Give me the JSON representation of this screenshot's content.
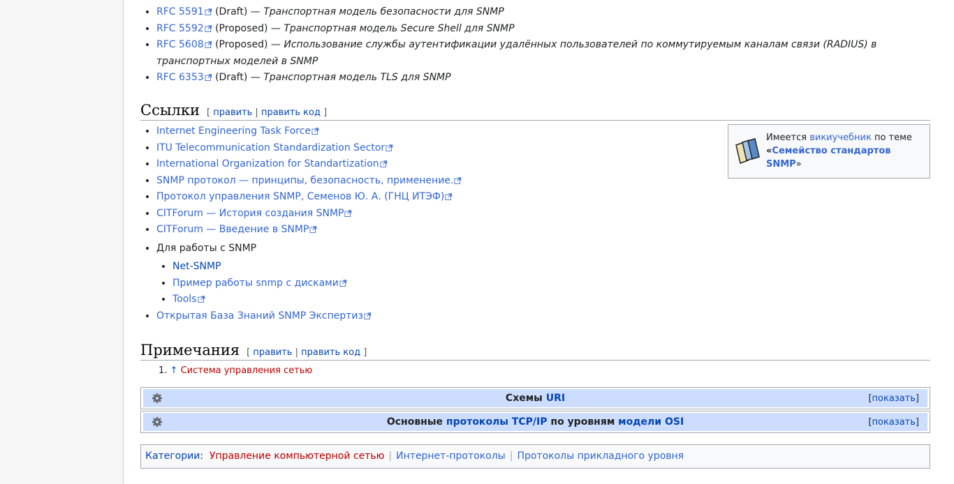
{
  "rfc_list": [
    {
      "link": "RFC 5591",
      "status": " (Draft) — ",
      "title": "Транспортная модель безопасности для SNMP"
    },
    {
      "link": "RFC 5592",
      "status": " (Proposed) — ",
      "title": "Транспортная модель Secure Shell для SNMP"
    },
    {
      "link": "RFC 5608",
      "status": " (Proposed) — ",
      "title": "Использование службы аутентификации удалённых пользователей по коммутируемым каналам связи (RADIUS) в транспортных моделей в SNMP"
    },
    {
      "link": "RFC 6353",
      "status": " (Draft) — ",
      "title": "Транспортная модель TLS для SNMP"
    }
  ],
  "links_section": {
    "heading": "Ссылки",
    "edit": "править",
    "edit_code": "править код",
    "items": [
      "Internet Engineering Task Force",
      "ITU Telecommunication Standardization Sector",
      "International Organization for Standartization",
      "SNMP протокол — принципы, безопасность, применение.",
      "Протокол управления SNMP, Семенов Ю. А. (ГНЦ ИТЭФ)",
      "CITForum — История создания SNMP",
      "CITForum — Введение в SNMP"
    ],
    "work_label": "Для работы с SNMP",
    "sub_items": {
      "net_snmp": "Net-SNMP",
      "disks": "Пример работы snmp с дисками",
      "tools": "Tools"
    },
    "last_item": "Открытая База Знаний SNMP Экспертиз"
  },
  "wikibook": {
    "prefix": "Имеется ",
    "link": "викиучебник",
    "suffix": " по теме",
    "open_quote": "«",
    "topic": "Семейство стандартов SNMP",
    "close_quote": "»"
  },
  "notes_section": {
    "heading": "Примечания",
    "edit": "править",
    "edit_code": "править код",
    "note_number": "1.",
    "note_arrow": "↑",
    "note_text": "Система управления сетью"
  },
  "navboxes": [
    {
      "part1": "Схемы ",
      "link1": "URI",
      "show": "показать"
    },
    {
      "part1": "Основные ",
      "link1": "протоколы TCP/IP",
      "part2": " по уровням ",
      "link2": "модели OSI",
      "show": "показать"
    }
  ],
  "categories": {
    "label": "Категории",
    "items": [
      "Управление компьютерной сетью",
      "Интернет-протоколы",
      "Протоколы прикладного уровня"
    ]
  }
}
